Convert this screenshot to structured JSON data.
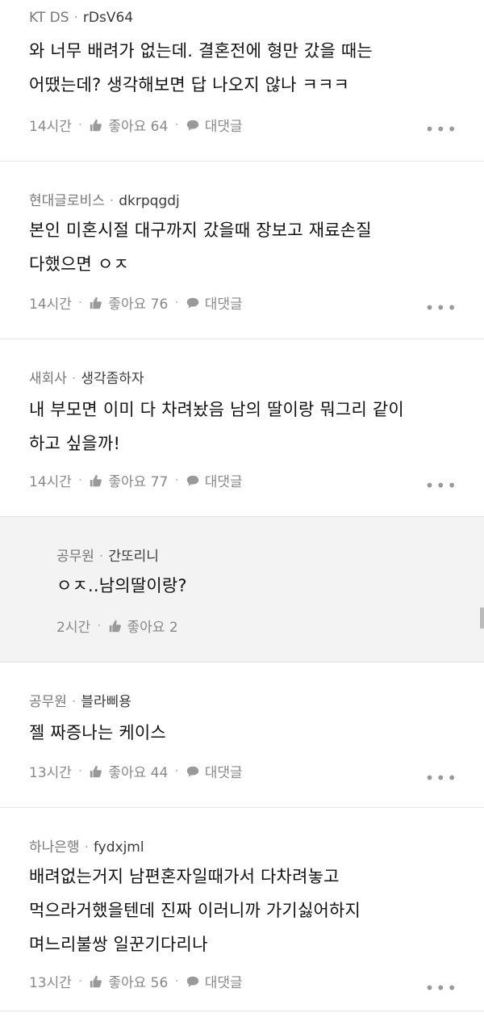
{
  "comments": [
    {
      "company": "KT DS",
      "author": "rDsV64",
      "lines": [
        "와 너무 배려가 없는데. 결혼전에 형만 갔을 때는",
        "어땠는데? 생각해보면 답 나오지 않나 ㅋㅋㅋ"
      ],
      "time": "14시간",
      "like_label": "좋아요 64",
      "reply_label": "대댓글"
    },
    {
      "company": "현대글로비스",
      "author": "dkrpqgdj",
      "lines": [
        "본인 미혼시절 대구까지 갔을때 장보고 재료손질",
        "다했으면 ㅇㅈ"
      ],
      "time": "14시간",
      "like_label": "좋아요 76",
      "reply_label": "대댓글"
    },
    {
      "company": "새회사",
      "author": "생각좀하자",
      "lines": [
        "내 부모면 이미 다 차려놨음 남의 딸이랑 뭐그리 같이",
        "하고 싶을까!"
      ],
      "time": "14시간",
      "like_label": "좋아요 77",
      "reply_label": "대댓글"
    },
    {
      "company": "공무원",
      "author": "간또리니",
      "lines": [
        "ㅇㅈ..남의딸이랑?"
      ],
      "time": "2시간",
      "like_label": "좋아요 2"
    },
    {
      "company": "공무원",
      "author": "블라삐용",
      "lines": [
        "젤 짜증나는 케이스"
      ],
      "time": "13시간",
      "like_label": "좋아요 44",
      "reply_label": "대댓글"
    },
    {
      "company": "하나은행",
      "author": "fydxjml",
      "lines": [
        "배려없는거지 남편혼자일때가서 다차려놓고",
        "먹으라거했을텐데 진짜 이러니까 가기싫어하지",
        "며느리불쌍 일꾼기다리나"
      ],
      "time": "13시간",
      "like_label": "좋아요 56",
      "reply_label": "대댓글"
    }
  ],
  "icons": {
    "like": "thumbs-up-icon",
    "reply": "speech-bubble-icon",
    "more": "more-dots-icon"
  },
  "colors": {
    "reply_background": "#f3f3f3",
    "divider": "#e4e4e4",
    "muted_text": "#888888"
  }
}
